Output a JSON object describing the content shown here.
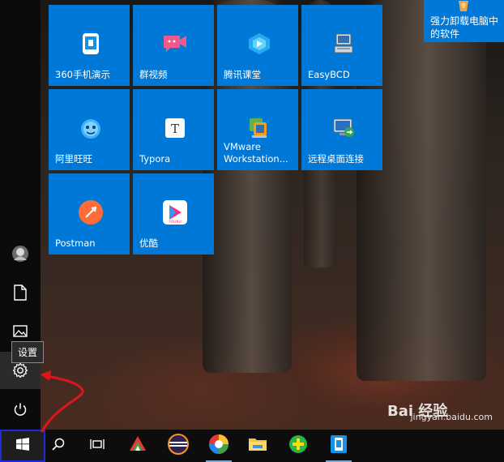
{
  "start_menu": {
    "rail": {
      "tooltip": "设置",
      "items": [
        {
          "name": "avatar",
          "icon": "user-avatar-icon"
        },
        {
          "name": "documents",
          "icon": "document-icon"
        },
        {
          "name": "pictures",
          "icon": "picture-icon"
        },
        {
          "name": "settings",
          "icon": "gear-icon"
        },
        {
          "name": "power",
          "icon": "power-icon"
        }
      ]
    },
    "tiles": [
      {
        "label": "360手机演示",
        "icon": "phone-screen-icon"
      },
      {
        "label": "群视频",
        "icon": "video-chat-icon"
      },
      {
        "label": "腾讯课堂",
        "icon": "tencent-classroom-icon"
      },
      {
        "label": "EasyBCD",
        "icon": "computer-icon"
      },
      {
        "label": "阿里旺旺",
        "icon": "aliwangwang-icon"
      },
      {
        "label": "Typora",
        "icon": "typora-icon"
      },
      {
        "label": "VMware Workstation...",
        "icon": "vmware-icon"
      },
      {
        "label": "远程桌面连接",
        "icon": "remote-desktop-icon"
      },
      {
        "label": "Postman",
        "icon": "postman-icon"
      },
      {
        "label": "优酷",
        "icon": "youku-icon"
      }
    ],
    "side_tile": {
      "label": "强力卸载电脑中的软件",
      "icon": "recycle-icon"
    }
  },
  "taskbar": {
    "items": [
      {
        "name": "start",
        "icon": "windows-logo-icon"
      },
      {
        "name": "search",
        "icon": "search-icon"
      },
      {
        "name": "task-view",
        "icon": "task-view-icon"
      },
      {
        "name": "app-1",
        "icon": "colorful-app-icon"
      },
      {
        "name": "eclipse",
        "icon": "eclipse-icon"
      },
      {
        "name": "app-3",
        "icon": "rainbow-app-icon"
      },
      {
        "name": "file-explorer",
        "icon": "folder-icon"
      },
      {
        "name": "app-5",
        "icon": "green-plus-icon"
      },
      {
        "name": "app-6",
        "icon": "phone-screen-icon"
      }
    ]
  },
  "watermark": {
    "logo_text": "Bai 经验",
    "url": "jingyan.baidu.com"
  },
  "colors": {
    "tile_blue": "#0078d7",
    "rail_bg": "#0b0b0b",
    "taskbar_bg": "#0d0d0d",
    "annotation_red": "#e0151c",
    "highlight_blue": "#1e2bd6"
  }
}
